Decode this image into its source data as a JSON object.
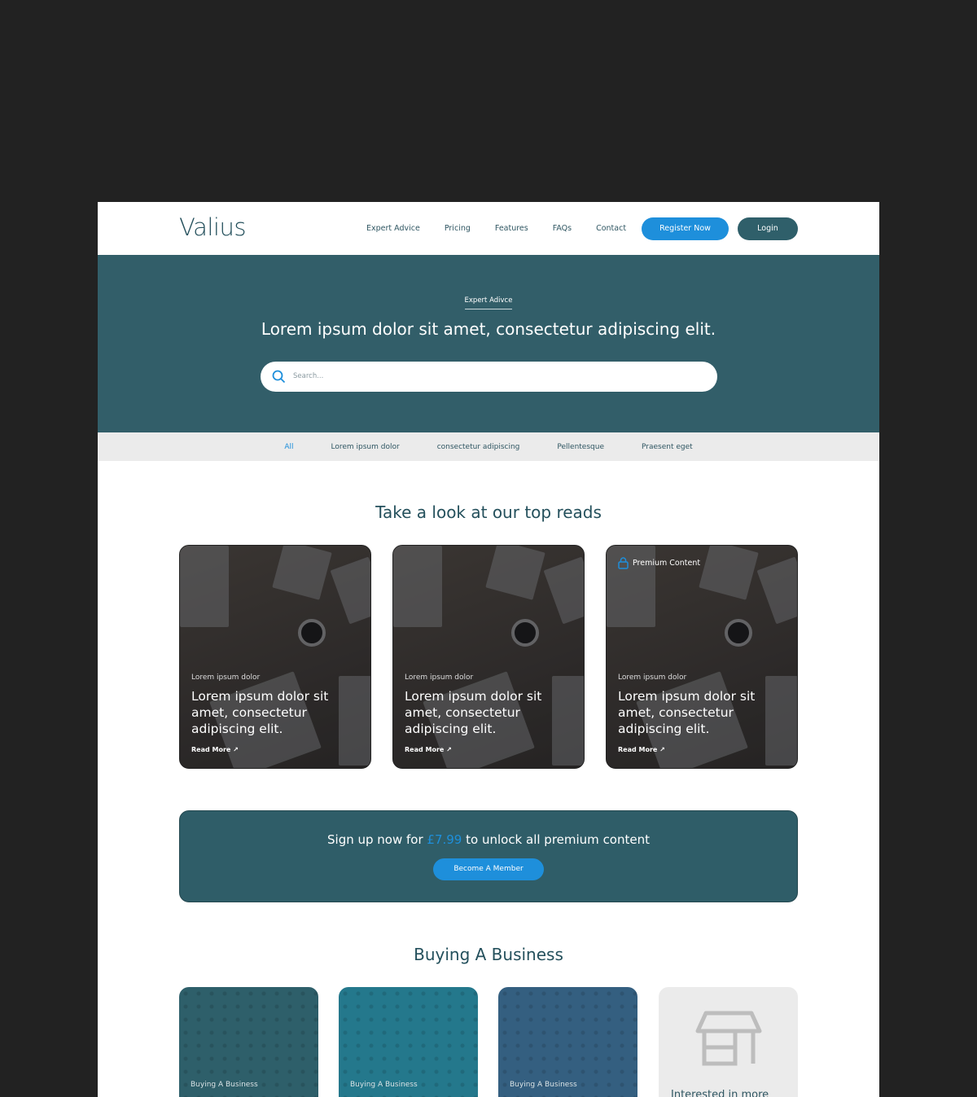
{
  "header": {
    "logo": "Valius",
    "nav": [
      "Expert Advice",
      "Pricing",
      "Features",
      "FAQs",
      "Contact"
    ],
    "register": "Register Now",
    "login": "Login"
  },
  "hero": {
    "eyebrow": "Expert Adivce",
    "title": "Lorem ipsum dolor sit amet, consectetur adipiscing elit.",
    "search_placeholder": "Search..."
  },
  "filters": [
    "All",
    "Lorem ipsum dolor",
    "consectetur adipiscing",
    "Pellentesque",
    "Praesent eget"
  ],
  "top_reads": {
    "title": "Take a look at our top reads",
    "cards": [
      {
        "category": "Lorem ipsum dolor",
        "title": "Lorem ipsum dolor sit amet, consectetur adipiscing elit.",
        "link": "Read More ↗"
      },
      {
        "category": "Lorem ipsum dolor",
        "title": "Lorem ipsum dolor sit amet, consectetur adipiscing elit.",
        "link": "Read More ↗"
      },
      {
        "badge": "Premium Content",
        "category": "Lorem ipsum dolor",
        "title": "Lorem ipsum dolor sit amet, consectetur adipiscing elit.",
        "link": "Read More ↗"
      }
    ]
  },
  "banner": {
    "pre": "Sign up now for ",
    "price": "£7.99",
    "post": " to unlock all premium content",
    "button": "Become A Member"
  },
  "buying": {
    "title": "Buying A Business",
    "cards": [
      {
        "label": "Buying A Business",
        "color": "#2e5f6a"
      },
      {
        "label": "Buying A Business",
        "color": "#24788c"
      },
      {
        "label": "Buying A Business",
        "color": "#345f80"
      }
    ],
    "more": "Interested in more"
  },
  "colors": {
    "accent": "#1e8fdb",
    "primary": "#325e69"
  }
}
